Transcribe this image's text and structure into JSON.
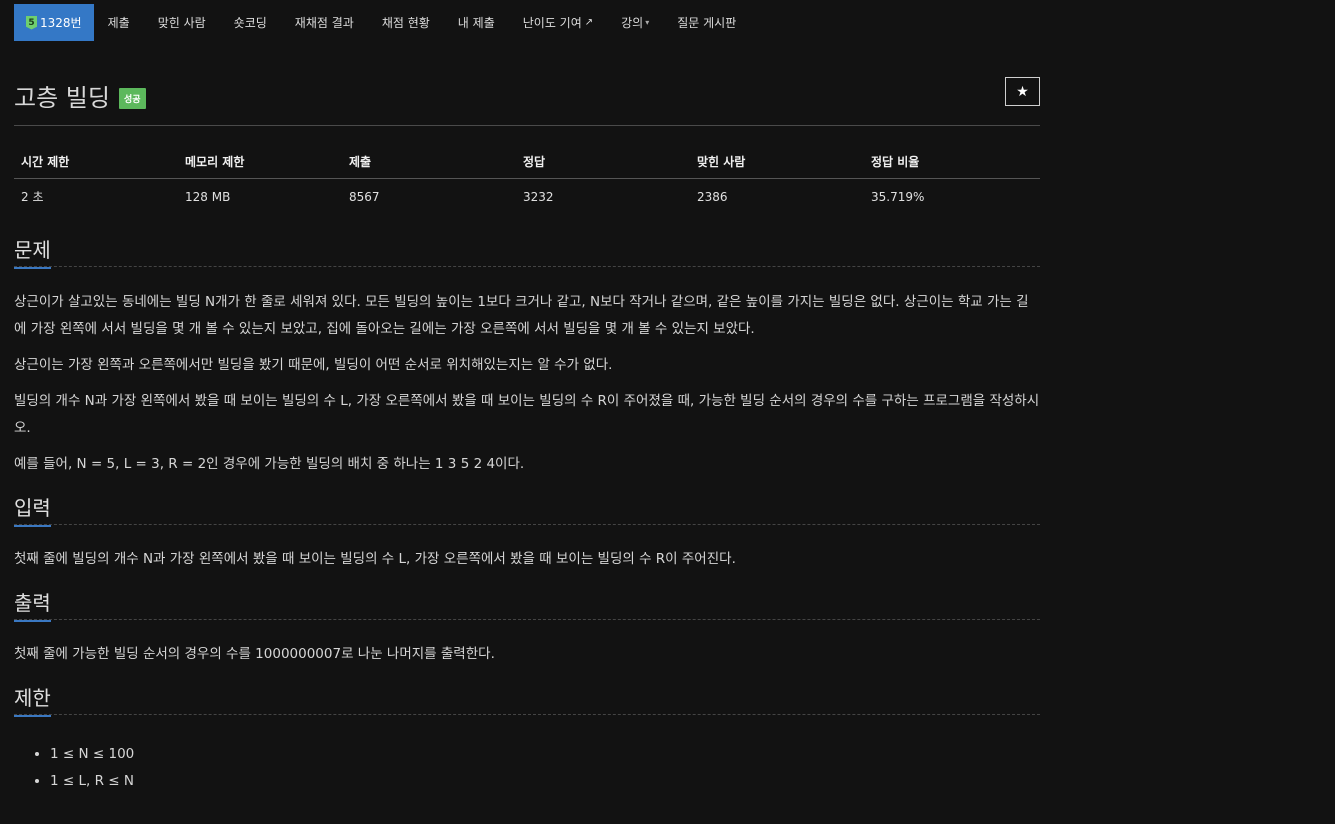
{
  "nav": {
    "problem_number": "1328번",
    "tier_mark": "5",
    "items": [
      "제출",
      "맞힌 사람",
      "숏코딩",
      "재채점 결과",
      "채점 현황",
      "내 제출",
      "난이도 기여",
      "강의",
      "질문 게시판"
    ]
  },
  "problem": {
    "title": "고층 빌딩",
    "badge": "성공",
    "star": "★"
  },
  "info_table": {
    "headers": [
      "시간 제한",
      "메모리 제한",
      "제출",
      "정답",
      "맞힌 사람",
      "정답 비율"
    ],
    "values": [
      "2 초",
      "128 MB",
      "8567",
      "3232",
      "2386",
      "35.719%"
    ]
  },
  "sections": {
    "description": {
      "title": "문제",
      "paragraphs": [
        "상근이가 살고있는 동네에는 빌딩 N개가 한 줄로 세워져 있다. 모든 빌딩의 높이는 1보다 크거나 같고, N보다 작거나 같으며, 같은 높이를 가지는 빌딩은 없다. 상근이는 학교 가는 길에 가장 왼쪽에 서서 빌딩을 몇 개 볼 수 있는지 보았고, 집에 돌아오는 길에는 가장 오른쪽에 서서 빌딩을 몇 개 볼 수 있는지 보았다.",
        "상근이는 가장 왼쪽과 오른쪽에서만 빌딩을 봤기 때문에, 빌딩이 어떤 순서로 위치해있는지는 알 수가 없다.",
        "빌딩의 개수 N과 가장 왼쪽에서 봤을 때 보이는 빌딩의 수 L, 가장 오른쪽에서 봤을 때 보이는 빌딩의 수 R이 주어졌을 때, 가능한 빌딩 순서의 경우의 수를 구하는 프로그램을 작성하시오.",
        "예를 들어, N = 5, L = 3, R = 2인 경우에 가능한 빌딩의 배치 중 하나는 1 3 5 2 4이다."
      ]
    },
    "input": {
      "title": "입력",
      "text": "첫째 줄에 빌딩의 개수 N과 가장 왼쪽에서 봤을 때 보이는 빌딩의 수 L, 가장 오른쪽에서 봤을 때 보이는 빌딩의 수 R이 주어진다."
    },
    "output": {
      "title": "출력",
      "text": "첫째 줄에 가능한 빌딩 순서의 경우의 수를 1000000007로 나눈 나머지를 출력한다."
    },
    "limits": {
      "title": "제한",
      "items": [
        "1 ≤ N ≤ 100",
        "1 ≤ L, R ≤ N"
      ]
    }
  }
}
